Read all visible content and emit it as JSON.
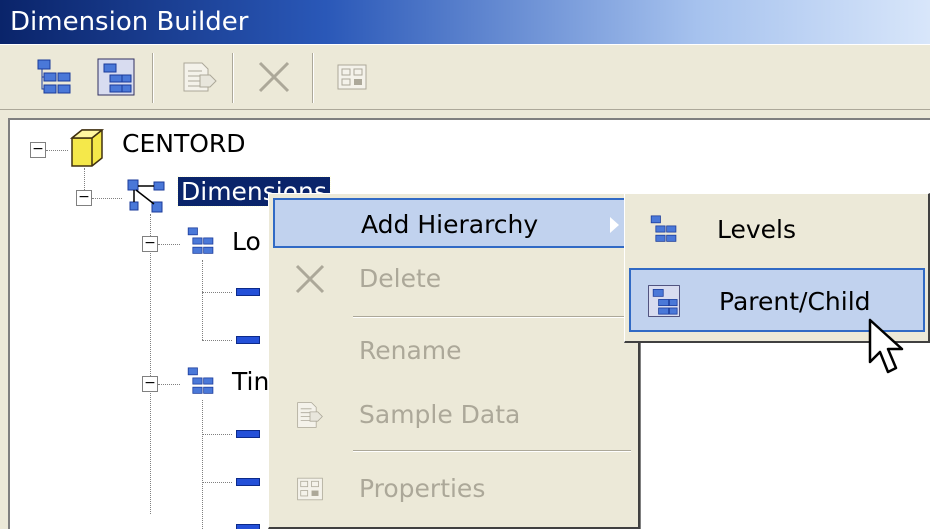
{
  "window": {
    "title": "Dimension Builder"
  },
  "toolbar": {
    "buttons": [
      {
        "icon": "levels-hierarchy-icon",
        "enabled": true
      },
      {
        "icon": "parent-child-hierarchy-icon",
        "enabled": true
      },
      {
        "icon": "sample-data-icon",
        "enabled": false
      },
      {
        "icon": "delete-icon",
        "enabled": false
      },
      {
        "icon": "properties-icon",
        "enabled": false
      }
    ]
  },
  "tree": {
    "root": {
      "label": "CENTORD",
      "icon": "cube-icon"
    },
    "dimensions": {
      "label": "Dimensions",
      "icon": "dimensions-icon"
    },
    "children": [
      {
        "label": "Lo",
        "icon": "hierarchy-icon"
      },
      {
        "label": "Tin",
        "icon": "hierarchy-icon"
      }
    ]
  },
  "context_menu": {
    "items": [
      {
        "label": "Add Hierarchy",
        "enabled": true,
        "highlighted": true,
        "has_submenu": true
      },
      {
        "label": "Delete",
        "enabled": false,
        "icon": "delete-icon"
      },
      {
        "label": "Rename",
        "enabled": false
      },
      {
        "label": "Sample Data",
        "enabled": false,
        "icon": "sample-data-icon"
      },
      {
        "label": "Properties",
        "enabled": false,
        "icon": "properties-icon"
      }
    ]
  },
  "submenu": {
    "items": [
      {
        "label": "Levels",
        "icon": "levels-hierarchy-icon",
        "highlighted": false
      },
      {
        "label": "Parent/Child",
        "icon": "parent-child-hierarchy-icon",
        "highlighted": true
      }
    ]
  },
  "colors": {
    "titlebar_start": "#0a246a",
    "selection": "#0a246a",
    "menu_highlight": "#c1d2ee",
    "menu_highlight_border": "#316ac5",
    "disabled_text": "#aca899"
  }
}
